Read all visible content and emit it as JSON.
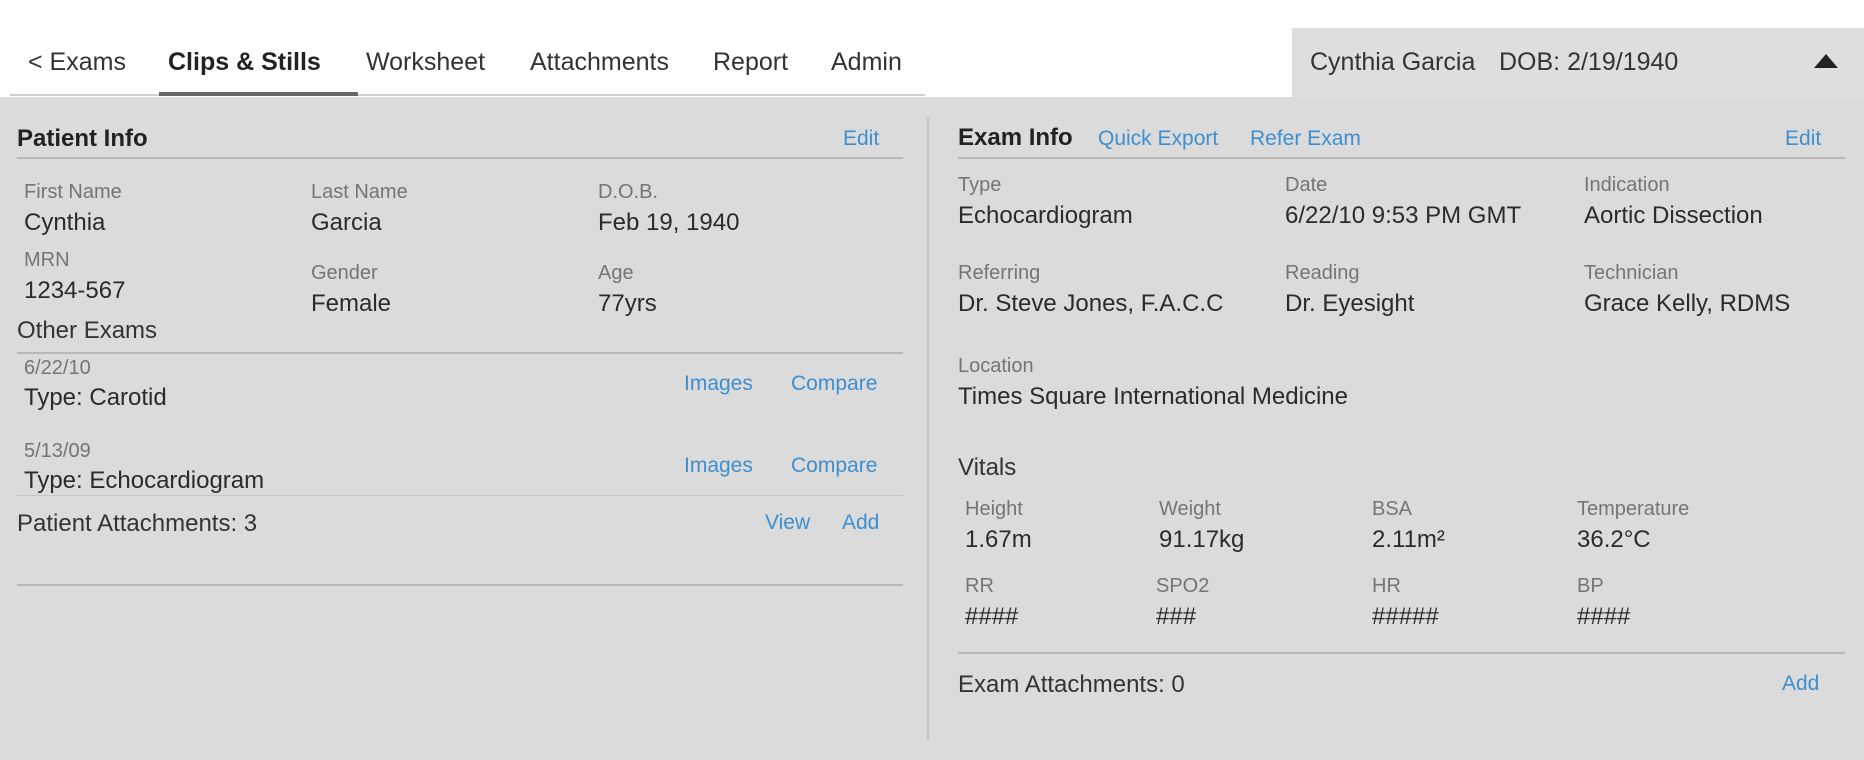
{
  "tabs": [
    {
      "label": "< Exams"
    },
    {
      "label": "Clips & Stills"
    },
    {
      "label": "Worksheet"
    },
    {
      "label": "Attachments"
    },
    {
      "label": "Report"
    },
    {
      "label": "Admin"
    }
  ],
  "active_tab": "Clips & Stills",
  "patient_bar": {
    "name": "Cynthia Garcia",
    "dob": "DOB: 2/19/1940"
  },
  "patient_info": {
    "title": "Patient Info",
    "edit": "Edit",
    "fields": {
      "first_name": {
        "label": "First Name",
        "value": "Cynthia"
      },
      "last_name": {
        "label": "Last Name",
        "value": "Garcia"
      },
      "dob": {
        "label": "D.O.B.",
        "value": "Feb 19, 1940"
      },
      "mrn": {
        "label": "MRN",
        "value": "1234-567"
      },
      "gender": {
        "label": "Gender",
        "value": "Female"
      },
      "age": {
        "label": "Age",
        "value": "77yrs"
      }
    }
  },
  "other_exams": {
    "title": "Other Exams",
    "items": [
      {
        "date": "6/22/10",
        "type": "Type: Carotid",
        "images": "Images",
        "compare": "Compare"
      },
      {
        "date": "5/13/09",
        "type": "Type: Echocardiogram",
        "images": "Images",
        "compare": "Compare"
      }
    ]
  },
  "patient_attachments": {
    "label": "Patient Attachments: 3",
    "view": "View",
    "add": "Add"
  },
  "exam_info": {
    "title": "Exam Info",
    "quick_export": "Quick Export",
    "refer_exam": "Refer Exam",
    "edit": "Edit",
    "fields": {
      "type": {
        "label": "Type",
        "value": "Echocardiogram"
      },
      "date": {
        "label": "Date",
        "value": "6/22/10 9:53 PM GMT"
      },
      "indication": {
        "label": "Indication",
        "value": "Aortic Dissection"
      },
      "referring": {
        "label": "Referring",
        "value": "Dr. Steve Jones, F.A.C.C"
      },
      "reading": {
        "label": "Reading",
        "value": "Dr. Eyesight"
      },
      "technician": {
        "label": "Technician",
        "value": "Grace Kelly, RDMS"
      },
      "location": {
        "label": "Location",
        "value": "Times Square International Medicine"
      }
    }
  },
  "vitals": {
    "title": "Vitals",
    "items": {
      "height": {
        "label": "Height",
        "value": "1.67m"
      },
      "weight": {
        "label": "Weight",
        "value": "91.17kg"
      },
      "bsa": {
        "label": "BSA",
        "value": "2.11m²"
      },
      "temperature": {
        "label": "Temperature",
        "value": "36.2°C"
      },
      "rr": {
        "label": "RR",
        "value": "####"
      },
      "spo2": {
        "label": "SPO2",
        "value": "###"
      },
      "hr": {
        "label": "HR",
        "value": "#####"
      },
      "bp": {
        "label": "BP",
        "value": "####"
      }
    }
  },
  "exam_attachments": {
    "label": "Exam Attachments: 0",
    "add": "Add"
  },
  "colors": {
    "link": "#3d8fd1",
    "panel_bg": "#dbdbdb",
    "patient_bar_bg": "#dedede"
  }
}
